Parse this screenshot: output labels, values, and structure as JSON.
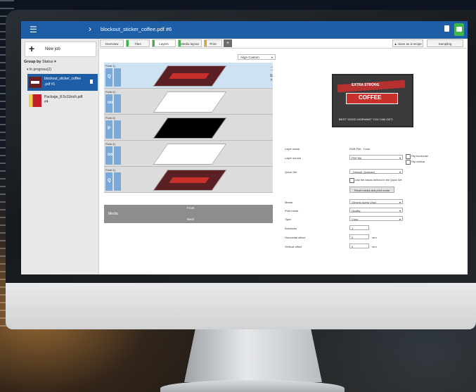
{
  "header": {
    "title": "blockout_sticker_coffee.pdf #6"
  },
  "jobs_panel": {
    "new_job_label": "New job",
    "group_by_label": "Group by",
    "group_by_value": "Status",
    "section_label": "▾ In progress(2)",
    "jobs": [
      {
        "name": "blockout_sticker_coffee.pdf #1",
        "number": "#6",
        "name_line": "blockout_sticker_coffee",
        "sub_line": ".pdf #1"
      },
      {
        "name_line": "Package_8.5x11inch.pdf",
        "sub_line": "#4"
      }
    ]
  },
  "tabs": [
    {
      "label": "Overview",
      "stripe": ""
    },
    {
      "label": "Tiles",
      "stripe": "#3fb64a"
    },
    {
      "label": "Layers",
      "stripe": "#3fb64a"
    },
    {
      "label": "Media layout",
      "stripe": "#3fb64a"
    },
    {
      "label": "Print",
      "stripe": "#f0a020"
    }
  ],
  "toolbar": {
    "save_recipe_label": "Save as a recipe",
    "sampling_label": "Sampling"
  },
  "align": {
    "value": "Align Custom"
  },
  "layers": [
    {
      "name": "Point 1)",
      "glyph": "Q",
      "selected": true
    },
    {
      "name": "Point 4)",
      "glyph": "oo",
      "selected": false
    },
    {
      "name": "Point 3)",
      "glyph": "P",
      "selected": false
    },
    {
      "name": "Point 4)",
      "glyph": "oo",
      "selected": false
    },
    {
      "name": "Point 1)",
      "glyph": "Q",
      "selected": false
    }
  ],
  "media_row": {
    "media_label": "Media",
    "front_label": "Front",
    "back_label": "Back"
  },
  "preview": {
    "line1": "EXTRA STRONG",
    "line2": "COFFEE",
    "line3": "BEST \"GOOD MORNING\" YOU CAN GET!"
  },
  "properties": {
    "layer_name_label": "Layer name",
    "layer_name_value": "RGB File - Color",
    "layer_source_label": "Layer source",
    "layer_source_value": "PDF file",
    "flip_horizontal": "Flip horizontal",
    "flip_vertical": "Flip vertical",
    "quick_set_label": "Quick Set",
    "quick_set_value": "_Default_Quickset_",
    "use_values_label": "Use the values defined in the Quick Set",
    "reset_button": "Reset media and print mode",
    "media_label": "Media",
    "media_value": "Generic Avery Vinyl",
    "print_mode_label": "Print mode",
    "print_mode_value": "Quality",
    "type_label": "Type",
    "type_value": "Color",
    "instances_label": "Instances",
    "instances_value": "1",
    "h_offset_label": "Horizontal offset",
    "h_offset_value": "0",
    "v_offset_label": "Vertical offset",
    "v_offset_value": "0",
    "unit": "mm"
  }
}
